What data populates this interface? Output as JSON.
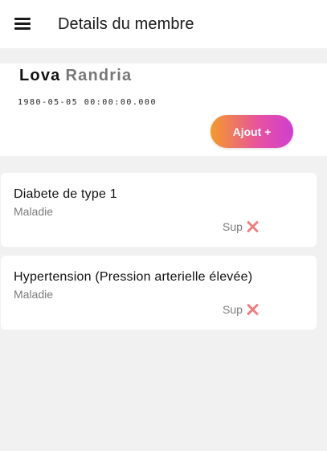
{
  "appbar": {
    "title": "Details du membre",
    "menu_icon": "menu-icon"
  },
  "member": {
    "first_name": "Lova",
    "last_name": "Randria",
    "birth_date": "1980-05-05 00:00:00.000",
    "add_label": "Ajout +",
    "add_gradient": [
      "#f49a2a",
      "#e651a2",
      "#cf3fd0"
    ]
  },
  "conditions": [
    {
      "title": "Diabete de type 1",
      "type": "Maladie",
      "delete_label": "Sup",
      "delete_icon": "cross-mark-icon"
    },
    {
      "title": "Hypertension (Pression arterielle élevée)",
      "type": "Maladie",
      "delete_label": "Sup",
      "delete_icon": "cross-mark-icon"
    }
  ],
  "colors": {
    "background": "#f1f1f1",
    "card": "#ffffff",
    "cross": "#ef7f7f"
  }
}
